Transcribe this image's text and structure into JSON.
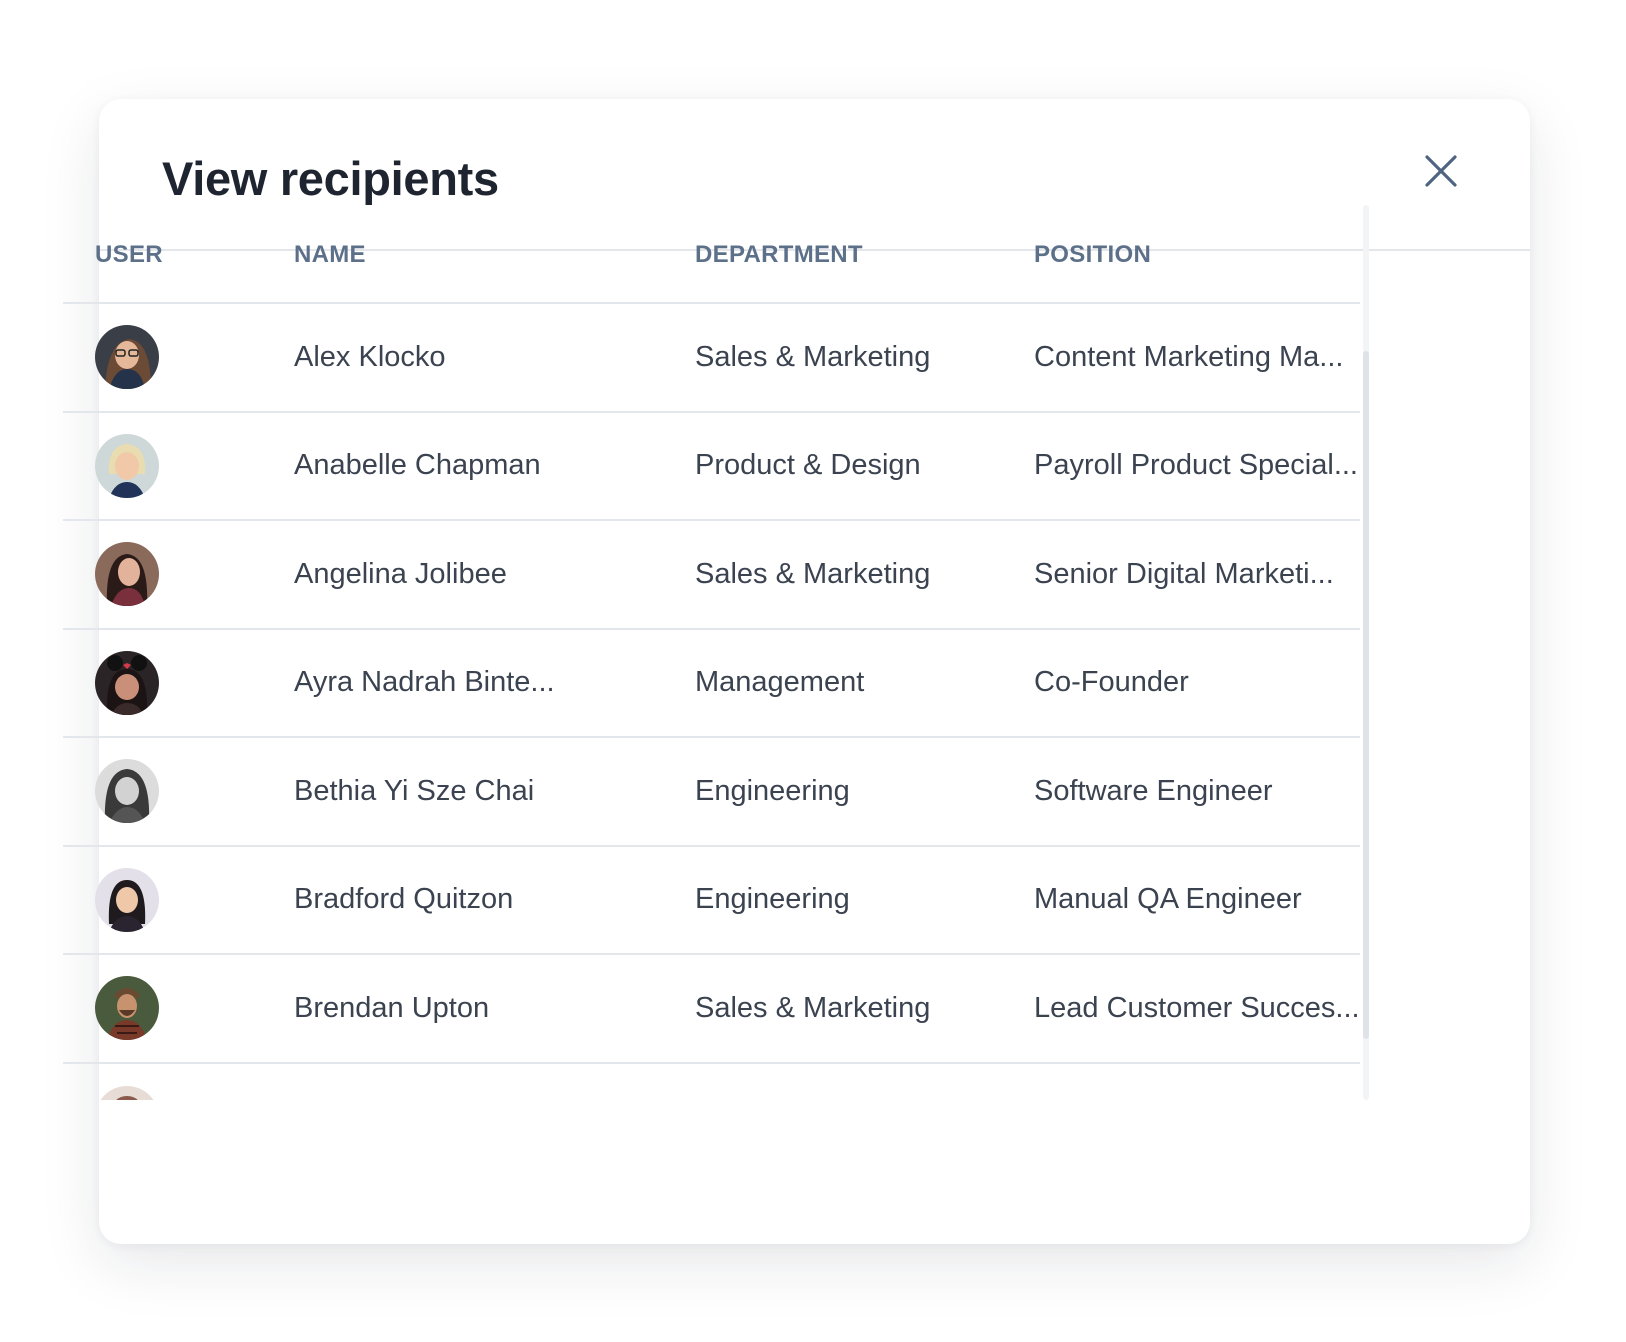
{
  "modal": {
    "title": "View recipients",
    "close_icon": "close-icon"
  },
  "table": {
    "columns": [
      "USER",
      "NAME",
      "DEPARTMENT",
      "POSITION"
    ],
    "rows": [
      {
        "avatar": "avatar-photo",
        "name": "Alex Klocko",
        "department": "Sales & Marketing",
        "position": "Content Marketing Ma..."
      },
      {
        "avatar": "avatar-photo",
        "name": "Anabelle Chapman",
        "department": "Product & Design",
        "position": "Payroll Product Special..."
      },
      {
        "avatar": "avatar-photo",
        "name": "Angelina Jolibee",
        "department": "Sales & Marketing",
        "position": "Senior Digital Marketi..."
      },
      {
        "avatar": "avatar-photo",
        "name": "Ayra Nadrah Binte...",
        "department": "Management",
        "position": "Co-Founder"
      },
      {
        "avatar": "avatar-photo",
        "name": "Bethia Yi Sze Chai",
        "department": "Engineering",
        "position": "Software Engineer"
      },
      {
        "avatar": "avatar-photo",
        "name": "Bradford Quitzon",
        "department": "Engineering",
        "position": "Manual QA Engineer"
      },
      {
        "avatar": "avatar-photo",
        "name": "Brendan Upton",
        "department": "Sales & Marketing",
        "position": "Lead Customer Succes..."
      }
    ]
  },
  "colors": {
    "title": "#1f2530",
    "header_text": "#5d7089",
    "body_text": "#3b4350",
    "divider": "#e3e6ea",
    "close_icon": "#4f6480"
  }
}
